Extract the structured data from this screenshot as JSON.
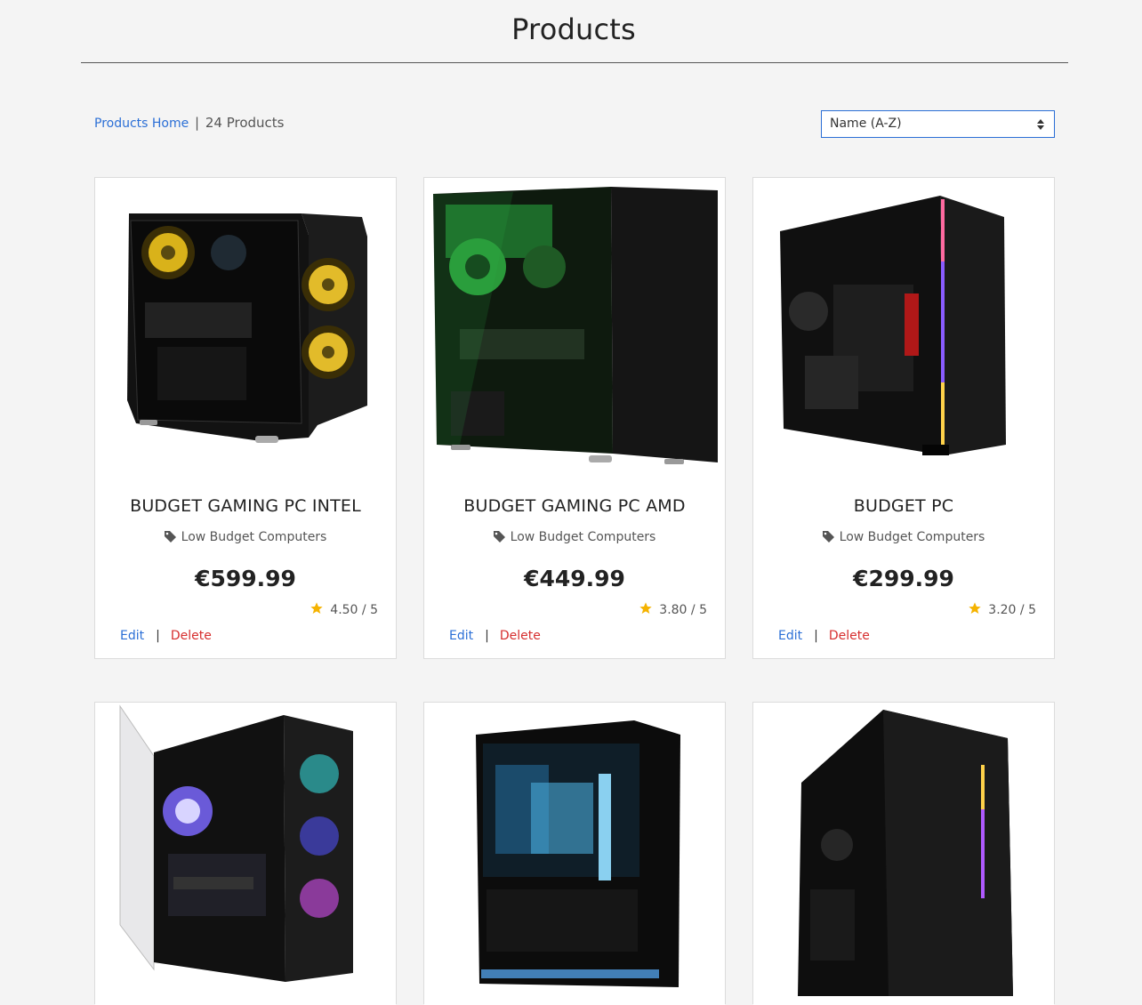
{
  "page": {
    "title": "Products"
  },
  "toolbar": {
    "home_link": "Products Home",
    "separator": "|",
    "count": "24 Products",
    "sort_value": "Name (A-Z)"
  },
  "products": [
    {
      "name": "BUDGET GAMING PC INTEL",
      "category": "Low Budget Computers",
      "price": "€599.99",
      "rating": "4.50 / 5",
      "edit": "Edit",
      "delete": "Delete",
      "image": "black pc case with yellow fans"
    },
    {
      "name": "BUDGET GAMING PC AMD",
      "category": "Low Budget Computers",
      "price": "€449.99",
      "rating": "3.80 / 5",
      "edit": "Edit",
      "delete": "Delete",
      "image": "black pc case with green lighting"
    },
    {
      "name": "BUDGET PC",
      "category": "Low Budget Computers",
      "price": "€299.99",
      "rating": "3.20 / 5",
      "edit": "Edit",
      "delete": "Delete",
      "image": "black pc case with rgb strip"
    },
    {
      "image": "black pc case with open glass door and rgb fans"
    },
    {
      "image": "black pc case with blue water cooling"
    },
    {
      "image": "black pc case with brushed front and rgb strip"
    }
  ],
  "colors": {
    "link": "#2b6fd6",
    "delete": "#d62e2e",
    "star": "#f5b301"
  }
}
